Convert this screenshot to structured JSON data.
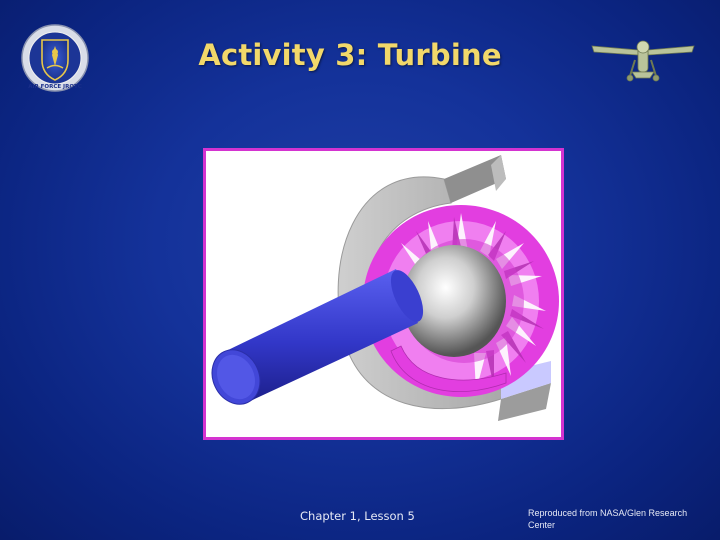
{
  "slide": {
    "title": "Activity 3: Turbine",
    "footer_center": "Chapter 1, Lesson 5",
    "footer_right": "Reproduced from NASA/Glen Research Center"
  },
  "logos": {
    "left": {
      "icon": "air-force-jrotc-shield-icon",
      "text": "AIR FORCE JROTC"
    },
    "right": {
      "icon": "airplane-wings-icon"
    }
  },
  "figure": {
    "icon": "turbine-diagram",
    "colors": {
      "frame": "#d433d0",
      "shaft": "#3a3fd0",
      "blades": "#e23ee0",
      "casing": "#b8b8b8"
    }
  },
  "colors": {
    "title": "#f2d86a",
    "background": "#14329a",
    "footer_text": "#e6e9f5"
  }
}
